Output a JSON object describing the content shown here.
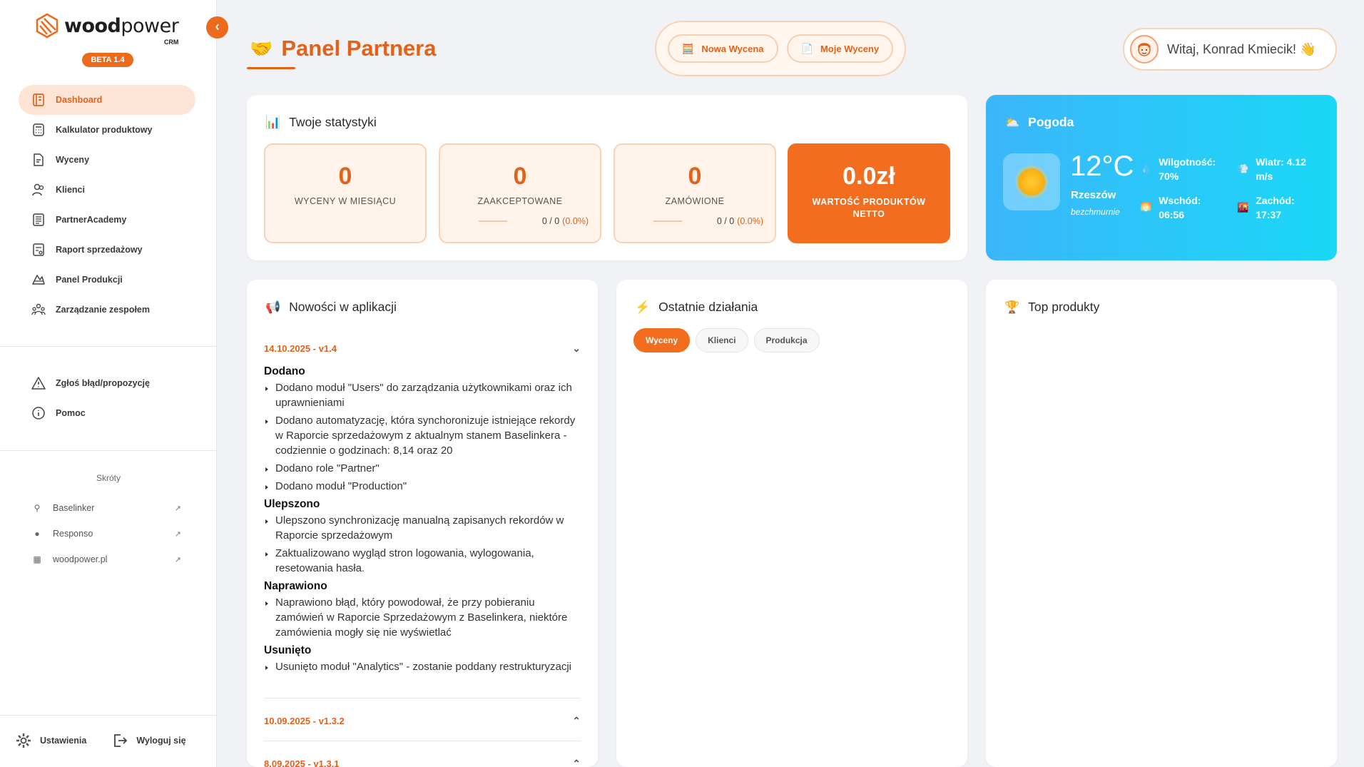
{
  "brand": {
    "name_bold": "wood",
    "name_light": "power",
    "sub": "CRM",
    "badge": "BETA 1.4"
  },
  "sidebar": {
    "nav": [
      {
        "label": "Dashboard",
        "icon": "dashboard-icon",
        "active": true
      },
      {
        "label": "Kalkulator produktowy",
        "icon": "calculator-icon"
      },
      {
        "label": "Wyceny",
        "icon": "document-icon"
      },
      {
        "label": "Klienci",
        "icon": "users-icon"
      },
      {
        "label": "PartnerAcademy",
        "icon": "academy-icon"
      },
      {
        "label": "Raport sprzedażowy",
        "icon": "report-icon"
      },
      {
        "label": "Panel Produkcji",
        "icon": "production-icon"
      },
      {
        "label": "Zarządzanie zespołem",
        "icon": "team-icon"
      }
    ],
    "support": [
      {
        "label": "Zgłoś błąd/propozycję",
        "icon": "warning-icon"
      },
      {
        "label": "Pomoc",
        "icon": "info-icon"
      }
    ],
    "shortcuts_title": "Skróty",
    "shortcuts": [
      {
        "label": "Baselinker"
      },
      {
        "label": "Responso"
      },
      {
        "label": "woodpower.pl"
      }
    ],
    "settings_label": "Ustawienia",
    "logout_label": "Wyloguj się"
  },
  "header": {
    "title": "Panel Partnera",
    "new_quote": "Nowa Wycena",
    "my_quotes": "Moje Wyceny",
    "greeting": "Witaj, Konrad Kmiecik! 👋"
  },
  "stats": {
    "title": "Twoje statystyki",
    "items": [
      {
        "value": "0",
        "label": "WYCENY W MIESIĄCU"
      },
      {
        "value": "0",
        "label": "ZAAKCEPTOWANE",
        "ratio": "0 / 0",
        "pct": "(0.0%)"
      },
      {
        "value": "0",
        "label": "ZAMÓWIONE",
        "ratio": "0 / 0",
        "pct": "(0.0%)"
      },
      {
        "value": "0.0zł",
        "label": "WARTOŚĆ PRODUKTÓW NETTO"
      }
    ]
  },
  "weather": {
    "title": "Pogoda",
    "temp": "12°C",
    "city": "Rzeszów",
    "desc": "bezchmurnie",
    "humidity": "Wilgotność: 70%",
    "wind": "Wiatr: 4.12 m/s",
    "sunrise": "Wschód: 06:56",
    "sunset": "Zachód: 17:37"
  },
  "news": {
    "title": "Nowości w aplikacji",
    "entries": [
      {
        "date": "14.10.2025 - v1.4"
      },
      {
        "date": "10.09.2025 - v1.3.2"
      },
      {
        "date": "8.09.2025 - v1.3.1"
      }
    ],
    "sections": [
      {
        "heading": "Dodano",
        "items": [
          "Dodano moduł \"Users\" do zarządzania użytkownikami oraz ich uprawnieniami",
          "Dodano automatyzację, która synchoronizuje istniejące rekordy w Raporcie sprzedażowym z aktualnym stanem Baselinkera - codziennie o godzinach: 8,14 oraz 20",
          "Dodano role \"Partner\"",
          "Dodano moduł \"Production\""
        ]
      },
      {
        "heading": "Ulepszono",
        "items": [
          "Ulepszono synchronizację manualną zapisanych rekordów w Raporcie sprzedażowym",
          "Zaktualizowano wygląd stron logowania, wylogowania, resetowania hasła."
        ]
      },
      {
        "heading": "Naprawiono",
        "items": [
          "Naprawiono błąd, który powodował, że przy pobieraniu zamówień w Raporcie Sprzedażowym z Baselinkera, niektóre zamówienia mogły się nie wyświetlać"
        ]
      },
      {
        "heading": "Usunięto",
        "items": [
          "Usunięto moduł \"Analytics\" - zostanie poddany restrukturyzacji"
        ]
      }
    ]
  },
  "activity": {
    "title": "Ostatnie działania",
    "tabs": [
      "Wyceny",
      "Klienci",
      "Produkcja"
    ]
  },
  "top_products": {
    "title": "Top produkty"
  },
  "colors": {
    "accent": "#e2621a",
    "accent_bg": "#fde4d4",
    "weather_from": "#3bb6fb",
    "weather_to": "#1ad8f6"
  }
}
